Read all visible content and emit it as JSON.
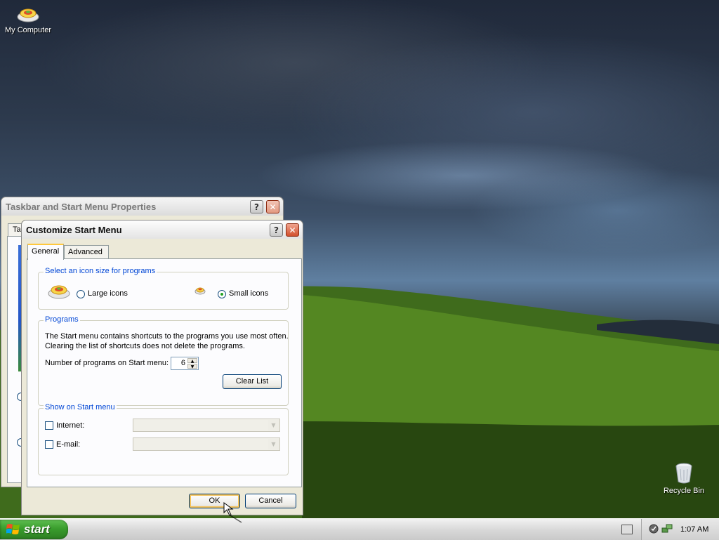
{
  "desktop": {
    "icons": [
      {
        "label": "My Computer"
      },
      {
        "label": "Recycle Bin"
      }
    ]
  },
  "bg_window": {
    "title": "Taskbar and Start Menu Properties",
    "tab_partial": "Ta"
  },
  "dialog": {
    "title": "Customize Start Menu",
    "tabs": [
      {
        "label": "General",
        "active": true
      },
      {
        "label": "Advanced",
        "active": false
      }
    ],
    "icon_size": {
      "legend": "Select an icon size for programs",
      "large_label": "Large icons",
      "small_label": "Small icons",
      "selected": "Small icons"
    },
    "programs": {
      "legend": "Programs",
      "desc_line1": "The Start menu contains shortcuts to the programs you use most often.",
      "desc_line2": "Clearing the list of shortcuts does not delete the programs.",
      "count_label": "Number of programs on Start menu:",
      "count_value": "6",
      "clear_button": "Clear List"
    },
    "show_on_start": {
      "legend": "Show on Start menu",
      "internet_label": "Internet:",
      "email_label": "E-mail:",
      "internet_checked": false,
      "email_checked": false
    },
    "ok_button": "OK",
    "cancel_button": "Cancel"
  },
  "taskbar": {
    "start_label": "start",
    "clock": "1:07 AM"
  },
  "colors": {
    "accent_blue": "#0046d5",
    "start_green": "#3a9d2d",
    "close_red": "#d2502d"
  }
}
